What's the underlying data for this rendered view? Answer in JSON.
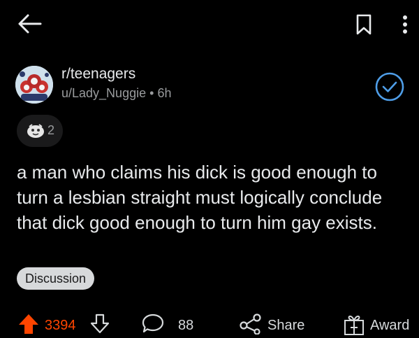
{
  "post": {
    "subreddit": "r/teenagers",
    "author": "u/Lady_Nuggie",
    "separator": "•",
    "age": "6h",
    "award_count": "2",
    "body": "a man who claims his dick is good enough to turn a lesbian straight must logically conclude that dick good enough to turn him gay exists.",
    "flair": "Discussion"
  },
  "actions": {
    "upvotes": "3394",
    "comments": "88",
    "share_label": "Share",
    "award_label": "Award"
  },
  "colors": {
    "upvote_active": "#ff4500",
    "join_accent": "#4f9ee8",
    "flair_bg": "#d7d9db"
  },
  "icons": [
    "back-arrow-icon",
    "bookmark-icon",
    "more-vertical-icon",
    "checkmark-icon",
    "award-emoji-icon",
    "upvote-icon",
    "downvote-icon",
    "comment-icon",
    "share-icon",
    "gift-icon"
  ]
}
